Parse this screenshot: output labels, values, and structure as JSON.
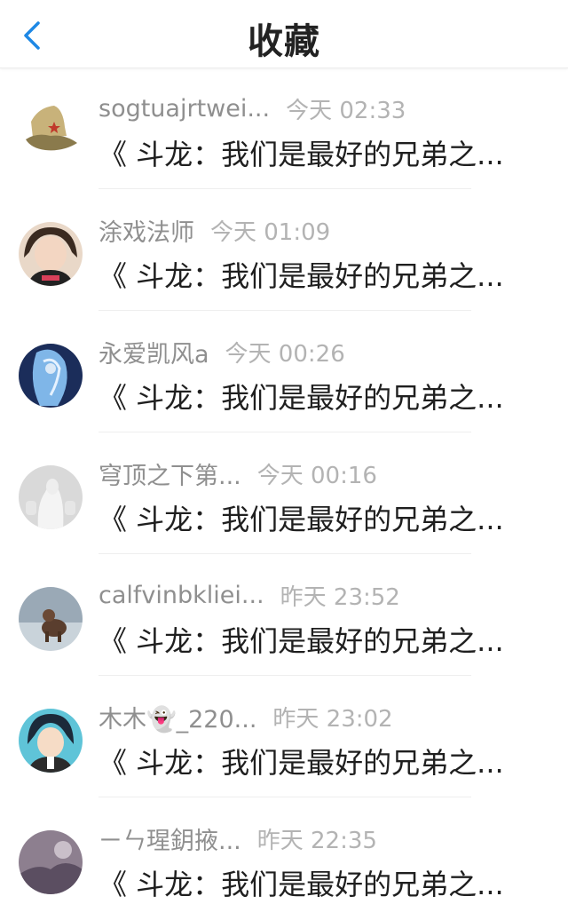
{
  "header": {
    "title": "收藏",
    "back_icon": "chevron-left-icon",
    "accent": "#1e88e5"
  },
  "items": [
    {
      "name": "sogtuajrtwei...",
      "time": "今天 02:33",
      "content": "《 斗龙：我们是最好的兄弟之..."
    },
    {
      "name": "涂戏法师",
      "time": "今天 01:09",
      "content": "《 斗龙：我们是最好的兄弟之..."
    },
    {
      "name": "永爱凯风a",
      "time": "今天 00:26",
      "content": "《 斗龙：我们是最好的兄弟之..."
    },
    {
      "name": "穹顶之下第...",
      "time": "今天 00:16",
      "content": "《 斗龙：我们是最好的兄弟之..."
    },
    {
      "name": "calfvinbkliei...",
      "time": "昨天 23:52",
      "content": "《 斗龙：我们是最好的兄弟之..."
    },
    {
      "name": "木木👻_220...",
      "time": "昨天 23:02",
      "content": "《 斗龙：我们是最好的兄弟之..."
    },
    {
      "name": "ㄧㄣ瑆鈅掖...",
      "time": "昨天 22:35",
      "content": "《 斗龙：我们是最好的兄弟之..."
    }
  ]
}
